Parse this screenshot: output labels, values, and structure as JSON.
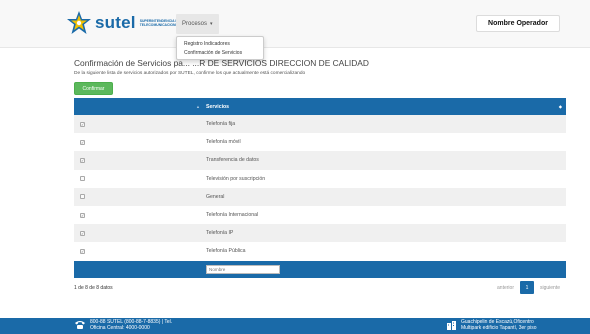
{
  "navbar": {
    "brand_word": "sutel",
    "brand_sub_line1": "SUPERINTENDENCIA DE",
    "brand_sub_line2": "TELECOMUNICACIONES",
    "menu_label": "Procesos",
    "user_label": "Nombre Operador"
  },
  "dropdown": {
    "items": [
      "Registro Indicadores",
      "Confirmación de Servicios"
    ]
  },
  "page": {
    "title": "Confirmación de Servicios pa... ...R DE SERVICIOS DIRECCION DE CALIDAD",
    "subtitle": "De la siguiente lista de servicios autorizados por SUTEL, confirme los que actualmente está comercializando",
    "confirm_label": "Confirmar"
  },
  "table": {
    "header_service": "Servicios",
    "rows": [
      {
        "service": "Telefonía fija",
        "checked": true
      },
      {
        "service": "Telefonía móvil",
        "checked": true
      },
      {
        "service": "Transferencia de datos",
        "checked": true
      },
      {
        "service": "Televisión por suscripción",
        "checked": false
      },
      {
        "service": "General",
        "checked": false
      },
      {
        "service": "Telefonía Internacional",
        "checked": true
      },
      {
        "service": "Telefonía IP",
        "checked": true
      },
      {
        "service": "Telefonía Pública",
        "checked": true
      }
    ],
    "filter_placeholder": "Nombre"
  },
  "pagination": {
    "info": "1 de 8 de 8 datos",
    "prev": "anterior",
    "current": "1",
    "next": "siguiente"
  },
  "footer": {
    "left_line1": "800-88 SUTEL (800-88-7-8835) | Tel.",
    "left_line2": "Oficina Central: 4000-0000",
    "right_line1": "Guachipelin de Escazú,Oficentro",
    "right_line2": "Multipark edificio Tapantí, 3er piso"
  },
  "colors": {
    "primary": "#1a6aa8",
    "success": "#5cb85c",
    "stripe": "#f0f0f0"
  }
}
